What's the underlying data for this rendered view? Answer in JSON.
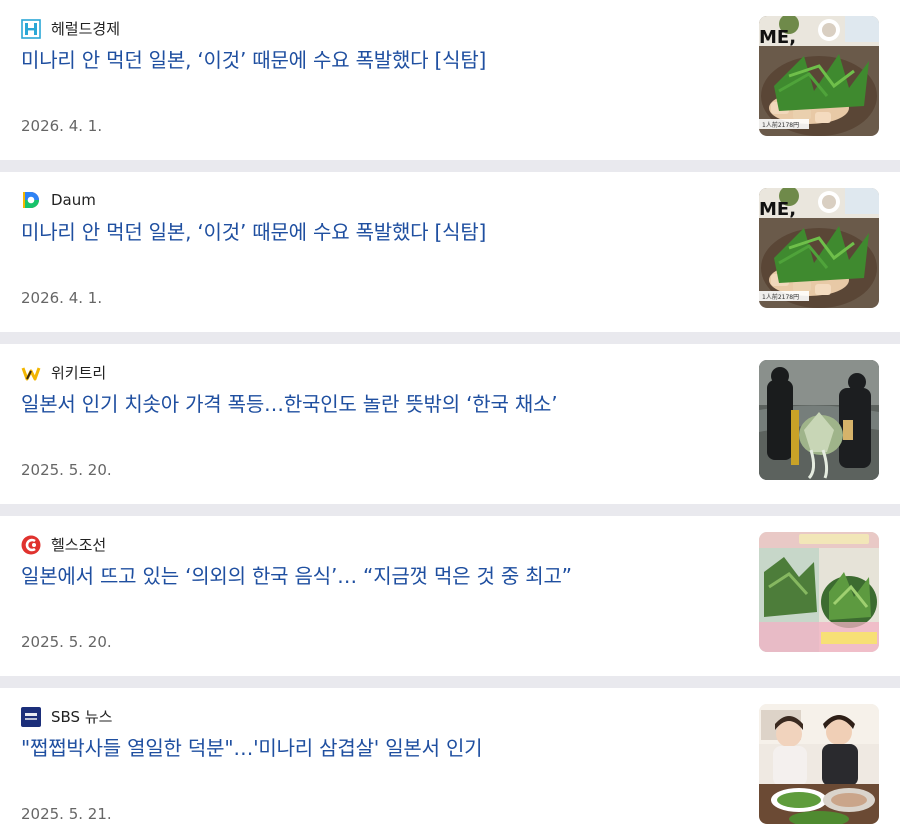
{
  "articles": [
    {
      "source": "헤럴드경제",
      "logo_icon": "herald-logo-icon",
      "headline": "미나리 안 먹던 일본, ‘이것’ 때문에 수요 폭발했다 [식탐]",
      "date": "2026. 4. 1.",
      "thumb_overlay": "ME,",
      "thumb_caption": "1人前2178円"
    },
    {
      "source": "Daum",
      "logo_icon": "daum-logo-icon",
      "headline": "미나리 안 먹던 일본, ‘이것’ 때문에 수요 폭발했다 [식탐]",
      "date": "2026. 4. 1.",
      "thumb_overlay": "ME,",
      "thumb_caption": "1人前2178円"
    },
    {
      "source": "위키트리",
      "logo_icon": "wikitree-logo-icon",
      "headline": "일본서 인기 치솟아 가격 폭등…한국인도 놀란 뜻밖의 ‘한국 채소’",
      "date": "2025. 5. 20."
    },
    {
      "source": "헬스조선",
      "logo_icon": "healthchosun-logo-icon",
      "headline": "일본에서 뜨고 있는 ‘의외의 한국 음식’… “지금껏 먹은 것 중 최고”",
      "date": "2025. 5. 20."
    },
    {
      "source": "SBS 뉴스",
      "logo_icon": "sbs-news-logo-icon",
      "headline": "\"쩝쩝박사들 열일한 덕분\"…'미나리 삼겹살' 일본서 인기",
      "date": "2025. 5. 21."
    }
  ],
  "colors": {
    "headline": "#1f4fa0",
    "date": "#666666",
    "divider": "#e9e9ee"
  }
}
